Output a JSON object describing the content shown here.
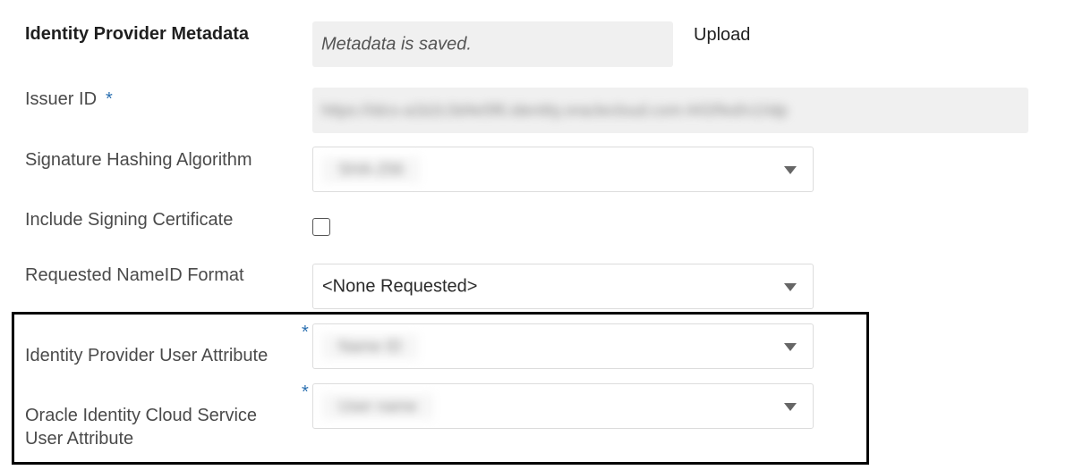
{
  "form": {
    "metadata": {
      "label": "Identity Provider Metadata",
      "value": "Metadata is saved.",
      "upload_label": "Upload"
    },
    "issuer_id": {
      "label": "Issuer ID",
      "required_mark": "*",
      "value": "https://idcs-a1b2c3d4e5f6.identity.oraclecloud.com:443/fed/v1/idp"
    },
    "signature_hashing": {
      "label": "Signature Hashing Algorithm",
      "value": "SHA-256"
    },
    "include_signing_cert": {
      "label": "Include Signing Certificate",
      "checked": false
    },
    "nameid_format": {
      "label": "Requested NameID Format",
      "value": "<None Requested>"
    },
    "idp_user_attribute": {
      "label": "Identity Provider User Attribute",
      "required_mark": "*",
      "value": "Name ID"
    },
    "idcs_user_attribute": {
      "label_line1": "Oracle Identity Cloud Service",
      "label_line2": "User Attribute",
      "required_mark": "*",
      "value": "User name"
    }
  },
  "colors": {
    "required": "#2a6fb0",
    "readonly_bg": "#f0f0f0",
    "highlight_border": "#000000"
  }
}
